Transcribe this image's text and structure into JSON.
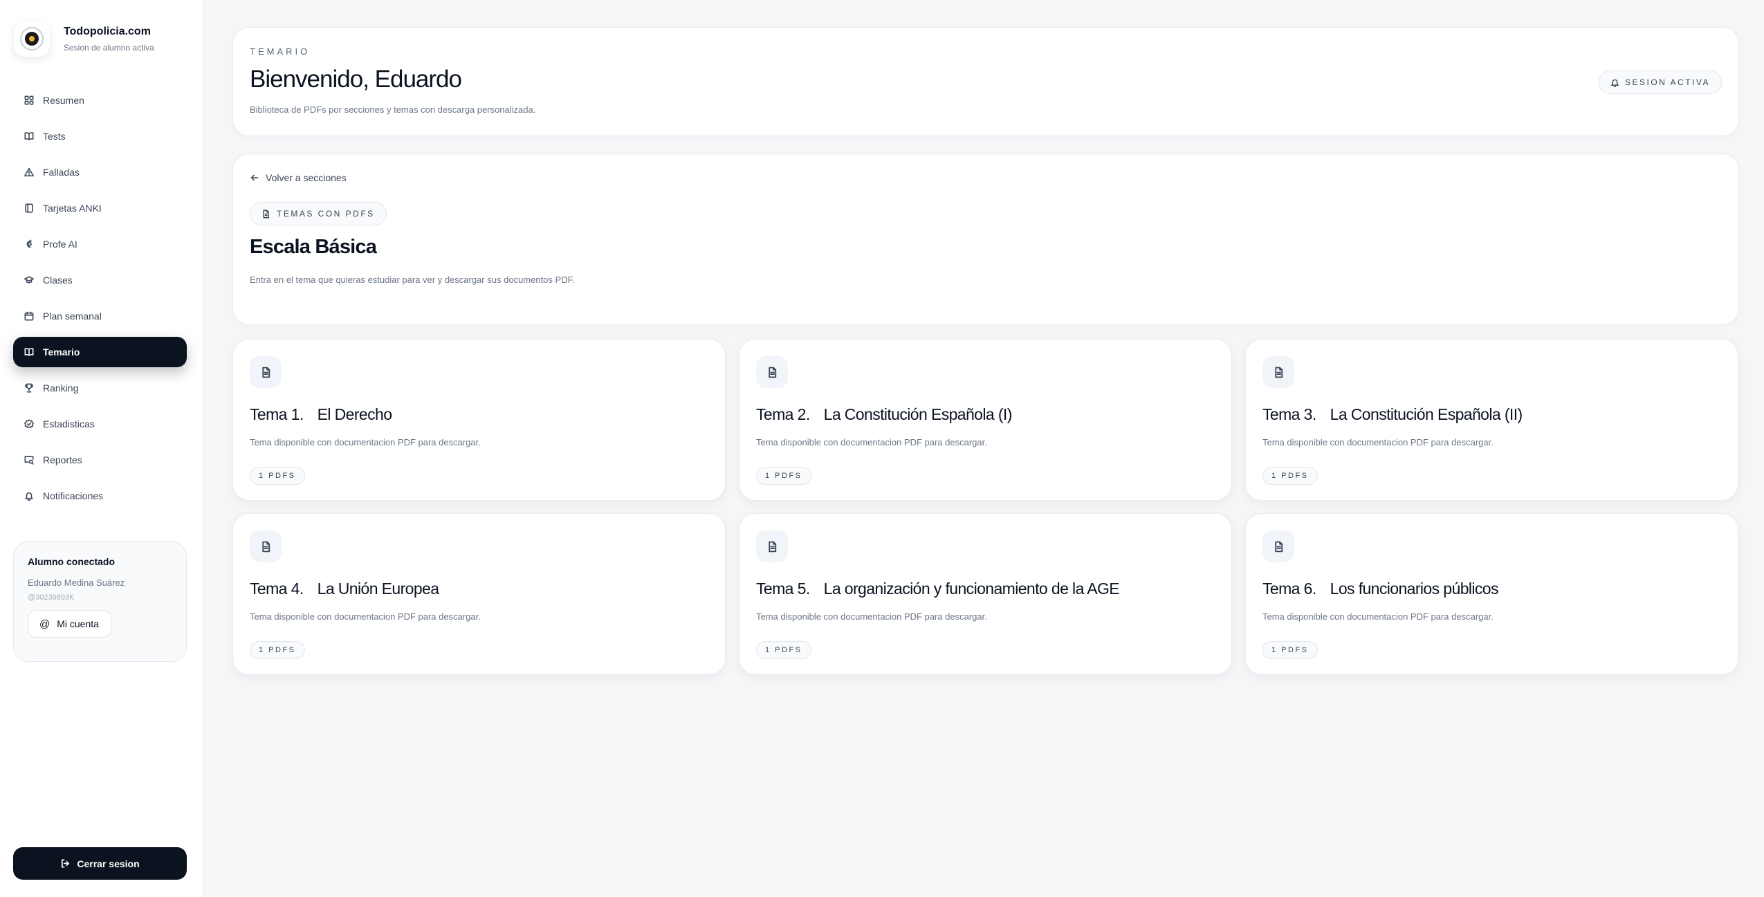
{
  "brand": {
    "name": "Todopolicia.com",
    "subtitle": "Sesion de alumno activa"
  },
  "sidebar": {
    "items": [
      {
        "label": "Resumen",
        "icon": "grid-icon",
        "active": false
      },
      {
        "label": "Tests",
        "icon": "book-open-icon",
        "active": false
      },
      {
        "label": "Falladas",
        "icon": "warning-triangle-icon",
        "active": false
      },
      {
        "label": "Tarjetas ANKI",
        "icon": "cards-icon",
        "active": false
      },
      {
        "label": "Profe AI",
        "icon": "ai-sparkle-icon",
        "active": false
      },
      {
        "label": "Clases",
        "icon": "graduation-cap-icon",
        "active": false
      },
      {
        "label": "Plan semanal",
        "icon": "calendar-icon",
        "active": false
      },
      {
        "label": "Temario",
        "icon": "book-open-icon",
        "active": true
      },
      {
        "label": "Ranking",
        "icon": "trophy-icon",
        "active": false
      },
      {
        "label": "Estadisticas",
        "icon": "badge-icon",
        "active": false
      },
      {
        "label": "Reportes",
        "icon": "message-search-icon",
        "active": false
      },
      {
        "label": "Notificaciones",
        "icon": "bell-icon",
        "active": false
      }
    ]
  },
  "user": {
    "title": "Alumno conectado",
    "name": "Eduardo Medina Suárez",
    "id": "@30239893K",
    "account_label": "Mi cuenta"
  },
  "logout_label": "Cerrar sesion",
  "header": {
    "eyebrow": "TEMARIO",
    "title": "Bienvenido, Eduardo",
    "description": "Biblioteca de PDFs por secciones y temas con descarga personalizada.",
    "session_badge": "SESION ACTIVA"
  },
  "section": {
    "back_label": "Volver a secciones",
    "pill": "TEMAS CON PDFS",
    "title": "Escala Básica",
    "description": "Entra en el tema que quieras estudiar para ver y descargar sus documentos PDF."
  },
  "topics": [
    {
      "number": "Tema 1.",
      "name": "El Derecho",
      "description": "Tema disponible con documentacion PDF para descargar.",
      "count": "1 PDFS"
    },
    {
      "number": "Tema 2.",
      "name": "La Constitución Española (I)",
      "description": "Tema disponible con documentacion PDF para descargar.",
      "count": "1 PDFS"
    },
    {
      "number": "Tema 3.",
      "name": "La Constitución Española (II)",
      "description": "Tema disponible con documentacion PDF para descargar.",
      "count": "1 PDFS"
    },
    {
      "number": "Tema 4.",
      "name": "La Unión Europea",
      "description": "Tema disponible con documentacion PDF para descargar.",
      "count": "1 PDFS"
    },
    {
      "number": "Tema 5.",
      "name": "La organización y funcionamiento de la AGE",
      "description": "Tema disponible con documentacion PDF para descargar.",
      "count": "1 PDFS"
    },
    {
      "number": "Tema 6.",
      "name": "Los funcionarios públicos",
      "description": "Tema disponible con documentacion PDF para descargar.",
      "count": "1 PDFS"
    }
  ]
}
